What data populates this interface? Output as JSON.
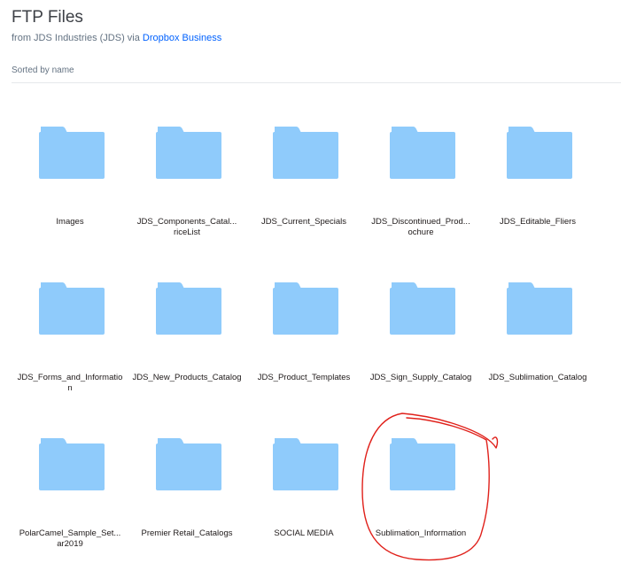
{
  "header": {
    "title": "FTP Files",
    "subtitle_prefix": "from JDS Industries (JDS) via ",
    "subtitle_link": "Dropbox Business"
  },
  "sort": {
    "label": "Sorted by name"
  },
  "colors": {
    "folder_body": "#8fcbfb",
    "folder_tab": "#8fcbfb",
    "link": "#0061fe",
    "annotation": "#e0201a"
  },
  "folders": [
    {
      "name": "Images",
      "icon": "folder-icon"
    },
    {
      "name": "JDS_Components_Catal...\nriceList",
      "icon": "folder-icon"
    },
    {
      "name": "JDS_Current_Specials",
      "icon": "folder-icon"
    },
    {
      "name": "JDS_Discontinued_Prod...\nochure",
      "icon": "folder-icon"
    },
    {
      "name": "JDS_Editable_Fliers",
      "icon": "folder-icon"
    },
    {
      "name": "JDS_Forms_and_Informatio\nn",
      "icon": "folder-icon"
    },
    {
      "name": "JDS_New_Products_Catalog",
      "icon": "folder-icon"
    },
    {
      "name": "JDS_Product_Templates",
      "icon": "folder-icon"
    },
    {
      "name": "JDS_Sign_Supply_Catalog",
      "icon": "folder-icon"
    },
    {
      "name": "JDS_Sublimation_Catalog",
      "icon": "folder-icon"
    },
    {
      "name": "PolarCamel_Sample_Set...\nar2019",
      "icon": "folder-icon"
    },
    {
      "name": "Premier Retail_Catalogs",
      "icon": "folder-icon"
    },
    {
      "name": "SOCIAL MEDIA",
      "icon": "folder-icon"
    },
    {
      "name": "Sublimation_Information",
      "icon": "folder-icon"
    }
  ]
}
